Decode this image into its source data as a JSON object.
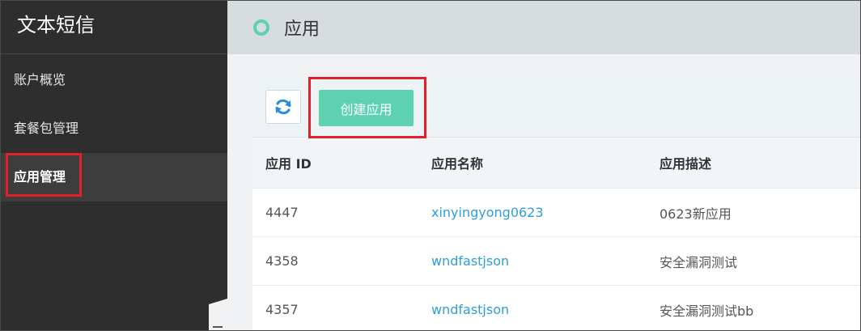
{
  "sidebar": {
    "brand": "文本短信",
    "items": [
      {
        "label": "账户概览"
      },
      {
        "label": "套餐包管理"
      },
      {
        "label": "应用管理"
      }
    ]
  },
  "header": {
    "title": "应用"
  },
  "toolbar": {
    "refresh_icon": "refresh-icon",
    "create_label": "创建应用"
  },
  "table": {
    "columns": [
      "应用 ID",
      "应用名称",
      "应用描述"
    ],
    "rows": [
      {
        "id": "4447",
        "name": "xinyingyong0623",
        "desc": "0623新应用"
      },
      {
        "id": "4358",
        "name": "wndfastjson",
        "desc": "安全漏洞测试"
      },
      {
        "id": "4357",
        "name": "wndfastjson",
        "desc": "安全漏洞测试bb"
      }
    ]
  },
  "colors": {
    "accent": "#5fd1b3",
    "link": "#2f9fd8",
    "highlight": "#e0202a"
  }
}
